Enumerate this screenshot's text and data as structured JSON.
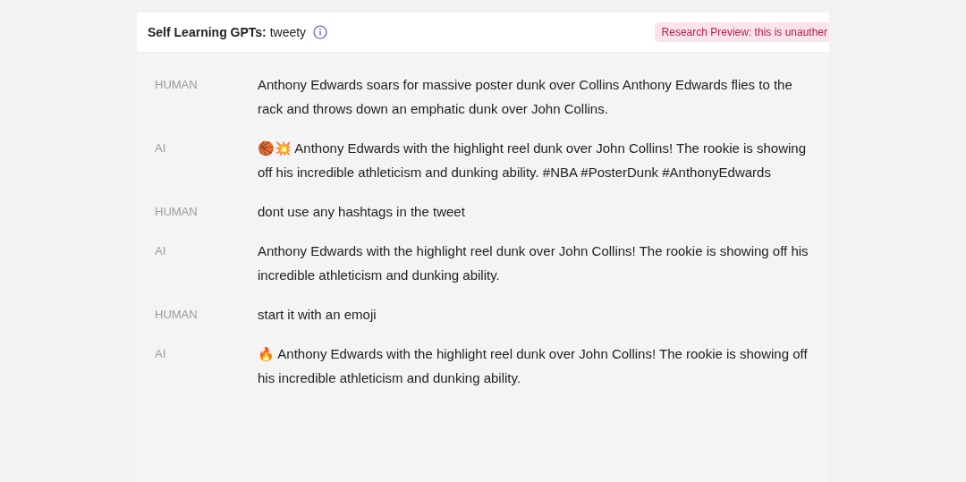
{
  "header": {
    "title": "**Self Learning GPTs:** tweety",
    "badge": "Research Preview: this is unauther"
  },
  "messages": [
    {
      "role": "HUMAN",
      "text": "Anthony Edwards soars for massive poster dunk over Collins Anthony Edwards flies to the rack and throws down an emphatic dunk over John Collins."
    },
    {
      "role": "AI",
      "text": "🏀💥 Anthony Edwards with the highlight reel dunk over John Collins! The rookie is showing off his incredible athleticism and dunking ability. #NBA #PosterDunk #AnthonyEdwards"
    },
    {
      "role": "HUMAN",
      "text": "dont use any hashtags in the tweet"
    },
    {
      "role": "AI",
      "text": "Anthony Edwards with the highlight reel dunk over John Collins! The rookie is showing off his incredible athleticism and dunking ability."
    },
    {
      "role": "HUMAN",
      "text": "start it with an emoji"
    },
    {
      "role": "AI",
      "text": "🔥 Anthony Edwards with the highlight reel dunk over John Collins! The rookie is showing off his incredible athleticism and dunking ability."
    }
  ]
}
